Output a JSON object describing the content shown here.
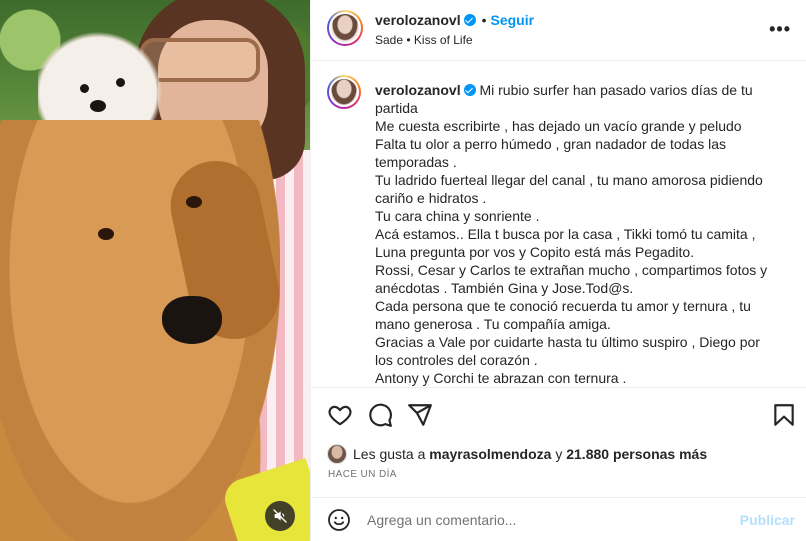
{
  "post": {
    "username": "verolozanovl",
    "follow_label": "Seguir",
    "dot": "•",
    "audio": "Sade • Kiss of Life",
    "more": "•••"
  },
  "caption": {
    "username": "verolozanovl",
    "lines": [
      "Mi rubio surfer han pasado varios días de tu",
      "partida",
      "Me cuesta escribirte , has dejado un vacío grande y peludo",
      "Falta tu olor a perro húmedo , gran nadador de todas las",
      "temporadas .",
      "Tu ladrido fuerteal llegar del canal , tu mano amorosa pidiendo",
      "cariño e hidratos .",
      "Tu cara china y sonriente .",
      "Acá estamos.. Ella t busca por la casa , Tikki tomó tu camita ,",
      "Luna pregunta por vos y Copito está más Pegadito.",
      "Rossi, Cesar y Carlos te extrañan mucho , compartimos fotos y",
      "anécdotas . También Gina y Jose.Tod@s.",
      "Cada persona que te conoció recuerda tu amor y ternura , tu",
      "mano generosa . Tu compañía amiga.",
      "Gracias a Vale por cuidarte hasta tu último suspiro , Diego por",
      "los controles del corazón .",
      "Antony y Corchi te abrazan con ternura ."
    ]
  },
  "likes": {
    "prefix": "Les gusta a",
    "user": "mayrasolmendoza",
    "connector": "y",
    "count": "21.880 personas más"
  },
  "timestamp": "HACE UN DÍA",
  "comment": {
    "placeholder": "Agrega un comentario...",
    "post_label": "Publicar"
  },
  "colors": {
    "accent": "#0095f6",
    "post_disabled": "#b2dffc",
    "muted_text": "#737373",
    "divider": "#efefef"
  },
  "icons": [
    "mute-icon",
    "more-options-icon",
    "heart-icon",
    "comment-icon",
    "share-icon",
    "bookmark-icon",
    "emoji-icon",
    "verified-badge-icon"
  ]
}
